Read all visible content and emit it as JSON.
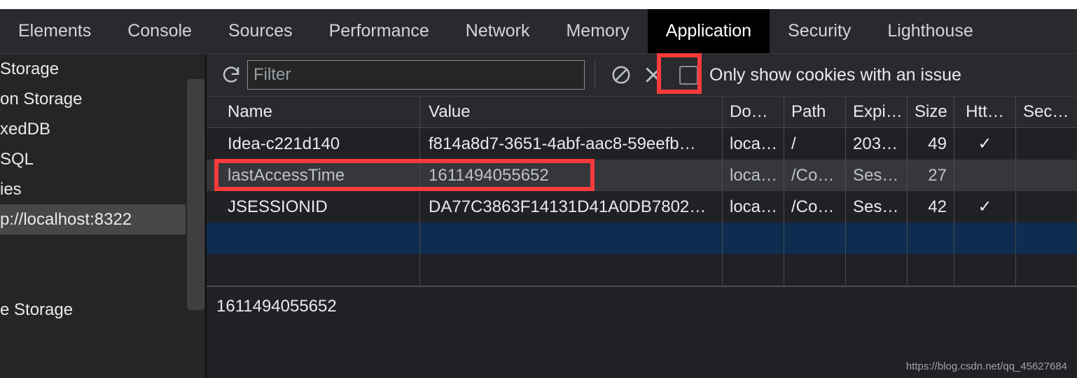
{
  "devtools": {
    "tabs": [
      {
        "label": "Elements",
        "selected": false
      },
      {
        "label": "Console",
        "selected": false
      },
      {
        "label": "Sources",
        "selected": false
      },
      {
        "label": "Performance",
        "selected": false
      },
      {
        "label": "Network",
        "selected": false
      },
      {
        "label": "Memory",
        "selected": false
      },
      {
        "label": "Application",
        "selected": true
      },
      {
        "label": "Security",
        "selected": false
      },
      {
        "label": "Lighthouse",
        "selected": false
      }
    ]
  },
  "sidebar": {
    "scrolled_horizontally": true,
    "items": [
      {
        "label": "Storage",
        "selected": false,
        "truncated_left": true
      },
      {
        "label": "on Storage",
        "selected": false,
        "truncated_left": true
      },
      {
        "label": "xedDB",
        "selected": false,
        "truncated_left": true
      },
      {
        "label": "SQL",
        "selected": false,
        "truncated_left": true
      },
      {
        "label": "ies",
        "selected": false,
        "truncated_left": true
      },
      {
        "label": "p://localhost:8322",
        "selected": true,
        "truncated_left": true
      }
    ],
    "bottom_item": {
      "label": "e Storage",
      "selected": false,
      "truncated_left": true
    }
  },
  "toolbar": {
    "refresh_icon": "refresh-icon",
    "filter_placeholder": "Filter",
    "filter_value": "",
    "clear_all_icon": "block-icon",
    "clear_icon": "close-x-icon",
    "checkbox_label": "Only show cookies with an issue",
    "checkbox_checked": false
  },
  "table": {
    "columns": [
      "Name",
      "Value",
      "Do…",
      "Path",
      "Expi…",
      "Size",
      "Htt…",
      "Sec…"
    ],
    "rows": [
      {
        "name": "Idea-c221d140",
        "value": "f814a8d7-3651-4abf-aac8-59eefb…",
        "domain": "loca…",
        "path": "/",
        "expires": "203…",
        "size": "49",
        "httponly": "✓",
        "secure": "",
        "state": "normal"
      },
      {
        "name": "lastAccessTime",
        "value": "1611494055652",
        "domain": "loca…",
        "path": "/Co…",
        "expires": "Ses…",
        "size": "27",
        "httponly": "",
        "secure": "",
        "state": "hovered"
      },
      {
        "name": "JSESSIONID",
        "value": "DA77C3863F14131D41A0DB7802…",
        "domain": "loca…",
        "path": "/Co…",
        "expires": "Ses…",
        "size": "42",
        "httponly": "✓",
        "secure": "",
        "state": "normal"
      },
      {
        "name": "",
        "value": "",
        "domain": "",
        "path": "",
        "expires": "",
        "size": "",
        "httponly": "",
        "secure": "",
        "state": "selected"
      },
      {
        "name": "",
        "value": "",
        "domain": "",
        "path": "",
        "expires": "",
        "size": "",
        "httponly": "",
        "secure": "",
        "state": "empty"
      }
    ]
  },
  "detail": {
    "value": "1611494055652"
  },
  "watermark": {
    "text": "https://blog.csdn.net/qq_45627684"
  },
  "annotations": {
    "clear_button_highlight": "red box around clear (X) button",
    "row_highlight": "red box around lastAccessTime row",
    "color": "#fb3b3b"
  },
  "colors": {
    "background": "#202124",
    "toolbar": "#292a2d",
    "selected_row": "#0d2c4f",
    "hovered_row": "#36373a",
    "annotation_red": "#fb3b3b",
    "text": "#e8eaed"
  }
}
